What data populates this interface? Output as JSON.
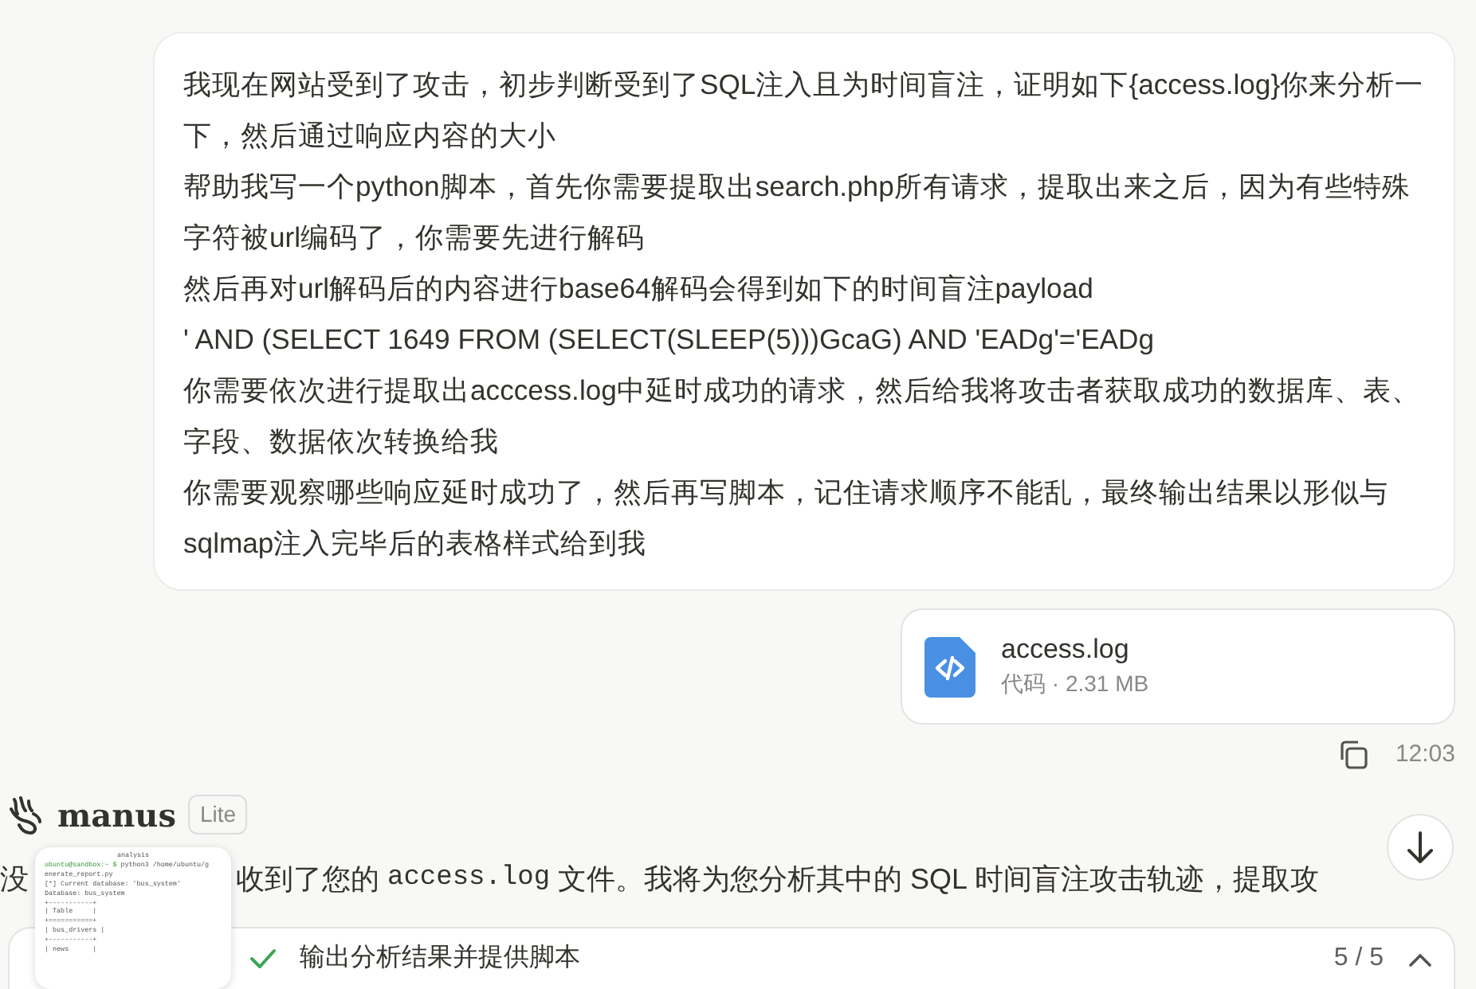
{
  "user_message": {
    "lines": [
      "我现在网站受到了攻击，初步判断受到了SQL注入且为时间盲注，证明如下{access.log}你来分析一下，然后通过响应内容的大小",
      "帮助我写一个python脚本，首先你需要提取出search.php所有请求，提取出来之后，因为有些特殊字符被url编码了，你需要先进行解码",
      "然后再对url解码后的内容进行base64解码会得到如下的时间盲注payload",
      "' AND (SELECT 1649 FROM (SELECT(SLEEP(5)))GcaG) AND 'EADg'='EADg",
      "你需要依次进行提取出acccess.log中延时成功的请求，然后给我将攻击者获取成功的数据库、表、字段、数据依次转换给我",
      "你需要观察哪些响应延时成功了，然后再写脚本，记住请求顺序不能乱，最终输出结果以形似与sqlmap注入完毕后的表格样式给到我"
    ]
  },
  "attachment": {
    "name": "access.log",
    "meta": "代码 · 2.31 MB"
  },
  "message_time": "12:03",
  "assistant": {
    "name": "manus",
    "plan": "Lite",
    "reply_parts": [
      {
        "text": "没"
      },
      {
        "text": "收到了您的 "
      },
      {
        "text": "access.log",
        "kind": "code"
      },
      {
        "text": " 文件。我将为您分析其中的 SQL 时间盲注攻击轨迹，提取攻"
      }
    ]
  },
  "task_bar": {
    "done": true,
    "step": "输出分析结果并提供脚本",
    "progress": "5 / 5"
  },
  "preview": {
    "title": "analysis",
    "lines": [
      {
        "text": "ubuntu@sandbox:~ $ ",
        "kind": "prompt",
        "rest": "python3 /home/ubuntu/g"
      },
      {
        "text": "enerate_report.py"
      },
      {
        "text": "[*] Current database: 'bus_system'"
      },
      {
        "text": "Database: bus_system"
      },
      {
        "text": "+-----------+"
      },
      {
        "text": "| Table     |"
      },
      {
        "text": "+===========+"
      },
      {
        "text": "| bus_drivers |"
      },
      {
        "text": "+-----------+"
      },
      {
        "text": "| news      |"
      }
    ]
  }
}
